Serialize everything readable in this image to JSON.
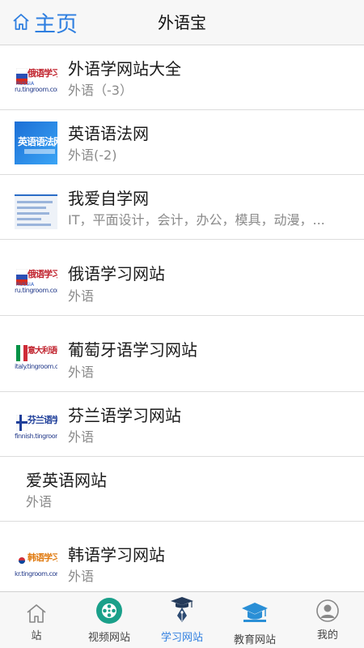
{
  "header": {
    "home_label": "主页",
    "title": "外语宝"
  },
  "list": {
    "items": [
      {
        "title": "外语学网站大全",
        "subtitle": "外语（-3）",
        "thumb": {
          "brand": "俄语学习网",
          "url": "ru.tingroom.com",
          "small": "RUSSIA"
        }
      },
      {
        "title": "英语语法网",
        "subtitle": "外语(-2)",
        "thumb": {
          "brand": "英语语法网"
        }
      },
      {
        "title": "我爱自学网",
        "subtitle": "IT，平面设计，会计，办公，模具，动漫，..."
      },
      {
        "title": "俄语学习网站",
        "subtitle": "外语",
        "thumb": {
          "brand": "俄语学习网",
          "url": "ru.tingroom.com",
          "small": "RUSSIA"
        }
      },
      {
        "title": "葡萄牙语学习网站",
        "subtitle": "外语",
        "thumb": {
          "brand": "意大利语学习网",
          "url": "italy.tingroom.com"
        }
      },
      {
        "title": "芬兰语学习网站",
        "subtitle": "外语",
        "thumb": {
          "brand": "芬兰语学习网",
          "url": "finnish.tingroom.com"
        }
      },
      {
        "title": "爱英语网站",
        "subtitle": "外语"
      },
      {
        "title": "韩语学习网站",
        "subtitle": "外语",
        "thumb": {
          "brand": "韩语学习网",
          "url": "kr.tingroom.com"
        }
      }
    ]
  },
  "nav": {
    "tabs": [
      {
        "label": "站",
        "icon": "home-icon"
      },
      {
        "label": "视频网站",
        "icon": "film-reel-icon"
      },
      {
        "label": "学习网站",
        "icon": "graduation-pen-icon",
        "active": true
      },
      {
        "label": "教育网站",
        "icon": "mortarboard-icon"
      },
      {
        "label": "我的",
        "icon": "user-avatar-icon"
      }
    ]
  },
  "colors": {
    "accent": "#2f7fe0",
    "header_bg": "#f7f7f7",
    "divider": "#dcdcdc",
    "subtitle": "#8a8a8a"
  }
}
